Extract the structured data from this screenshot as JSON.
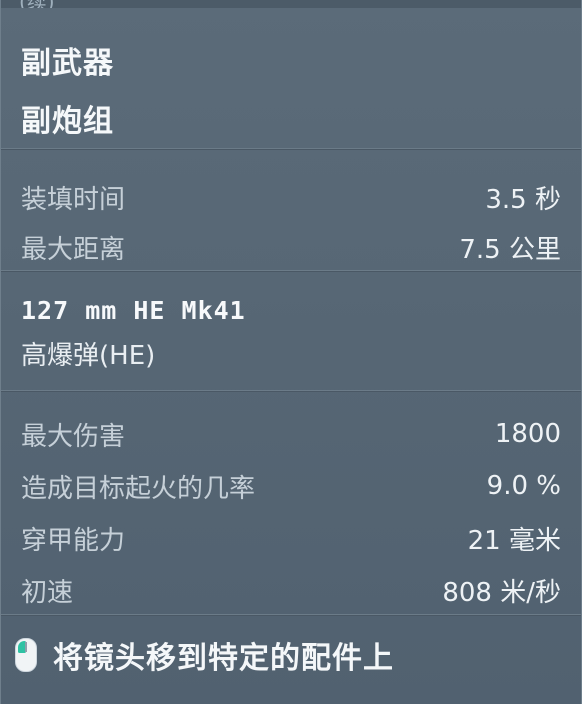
{
  "header": {
    "cut_text": "(续)"
  },
  "title": {
    "category": "副武器",
    "name": "副炮组"
  },
  "stats_main": [
    {
      "label": "装填时间",
      "value": "3.5 秒"
    },
    {
      "label": "最大距离",
      "value": "7.5 公里"
    }
  ],
  "ammo": {
    "name": "127 mm HE Mk41",
    "type": "高爆弹(HE)"
  },
  "stats_ammo": [
    {
      "label": "最大伤害",
      "value": "1800"
    },
    {
      "label": "造成目标起火的几率",
      "value": "9.0 %"
    },
    {
      "label": "穿甲能力",
      "value": "21 毫米"
    },
    {
      "label": "初速",
      "value": "808 米/秒"
    }
  ],
  "hint": {
    "icon": "mouse-left-click-icon",
    "text": "将镜头移到特定的配件上",
    "accent_color": "#2fc2a4"
  }
}
